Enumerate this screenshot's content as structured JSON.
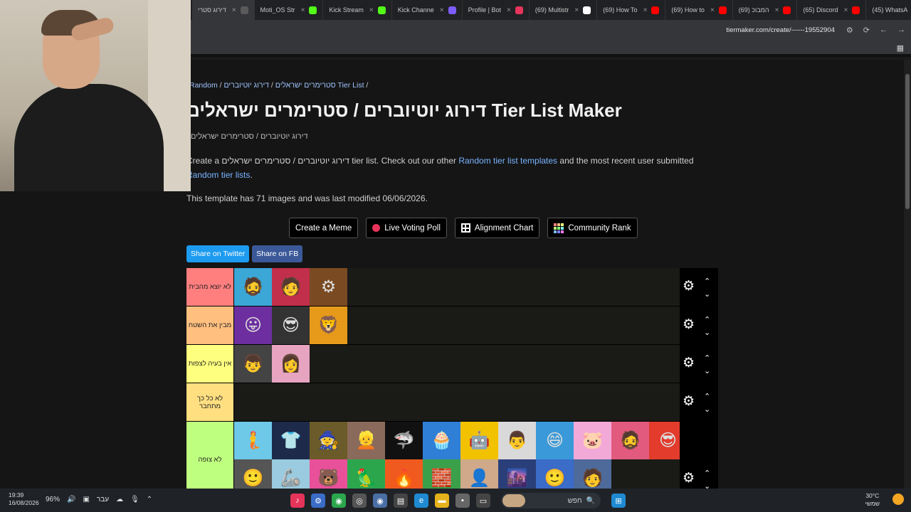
{
  "tabs": [
    {
      "title": "דירוג סטרי",
      "color": "#5a5a5a",
      "active": true
    },
    {
      "title": "Moti_OS Str",
      "color": "#53fc18"
    },
    {
      "title": "Kick Stream",
      "color": "#53fc18"
    },
    {
      "title": "Kick Channe",
      "color": "#7c5cfc"
    },
    {
      "title": "Profile | Bot",
      "color": "#e6345a"
    },
    {
      "title": "(69) Multistr",
      "color": "#ffffff"
    },
    {
      "title": "(69) How To",
      "color": "#ff0000"
    },
    {
      "title": "(69) How to",
      "color": "#ff0000"
    },
    {
      "title": "(69) המבוכ",
      "color": "#ff0000"
    },
    {
      "title": "(65) Discord",
      "color": "#ff0000"
    },
    {
      "title": "(45) WhatsA",
      "color": "#e6345a"
    }
  ],
  "address": {
    "url": "tiermaker.com/create/------19552904"
  },
  "breadcrumb": {
    "a": "Random",
    "b": "סטרימרים ישראלים",
    "c": "דירוג יוטיוברים Tier List",
    "sep": " / "
  },
  "title": "דירוג יוטיוברים / סטרימרים ישראלים Tier List Maker",
  "subtitle": "דירוג יוטיוברים / סטרימרים ישראלים",
  "description": {
    "pre": "Create a דירוג יוטיוברים / סטרימרים ישראלים tier list. Check out our other ",
    "link1": "Random tier list templates",
    "mid": " and the most recent user submitted ",
    "link2": "Random tier lists",
    "post": "."
  },
  "modified": "This template has 71 images and was last modified 06/06/2026.",
  "buttons": {
    "meme": "Create a Meme",
    "poll": "Live Voting Poll",
    "alignment": "Alignment Chart",
    "community": "Community Rank"
  },
  "share": {
    "twitter": "Share on Twitter",
    "fb": "Share on FB"
  },
  "tiers": [
    {
      "label": "לא יוצא מהבית",
      "color": "#ff7f7f"
    },
    {
      "label": "מבין את השטח",
      "color": "#ffbf7f"
    },
    {
      "label": "אין בעיה לצפות",
      "color": "#ffff7f"
    },
    {
      "label": "לא כל כך מתחבר",
      "color": "#ffdf80"
    },
    {
      "label": "לא צופה",
      "color": "#bfff7f"
    }
  ],
  "tier_items": {
    "t0": [
      {
        "icon": "🧔",
        "bg": "#3aa7d6"
      },
      {
        "icon": "🧑",
        "bg": "#c12f4a"
      },
      {
        "icon": "⚙",
        "bg": "#7a4a22"
      }
    ],
    "t1": [
      {
        "icon": "😛",
        "bg": "#6d2fa0"
      },
      {
        "icon": "😎",
        "bg": "#333333"
      },
      {
        "icon": "🦁",
        "bg": "#e79a1a"
      }
    ],
    "t2": [
      {
        "icon": "👦",
        "bg": "#444444"
      },
      {
        "icon": "👩",
        "bg": "#e6a4c0"
      }
    ],
    "t3": [],
    "t4": [
      {
        "icon": "🧜",
        "bg": "#6ec9e8"
      },
      {
        "icon": "👕",
        "bg": "#1e2a4a"
      },
      {
        "icon": "🧙",
        "bg": "#6b5b2a"
      },
      {
        "icon": "👱",
        "bg": "#8a6a5a"
      },
      {
        "icon": "🦈",
        "bg": "#111111"
      },
      {
        "icon": "🧁",
        "bg": "#2f7fd6"
      },
      {
        "icon": "🤖",
        "bg": "#f2c200"
      },
      {
        "icon": "👨",
        "bg": "#d9d9d9"
      },
      {
        "icon": "😄",
        "bg": "#3a9ad9"
      },
      {
        "icon": "🐷",
        "bg": "#f3a9d7"
      },
      {
        "icon": "🧔",
        "bg": "#e25a7e"
      },
      {
        "icon": "😎",
        "bg": "#e33b2c"
      },
      {
        "icon": "🙂",
        "bg": "#555555"
      },
      {
        "icon": "🦾",
        "bg": "#9acbe0"
      },
      {
        "icon": "🐻",
        "bg": "#e8509a"
      },
      {
        "icon": "🦜",
        "bg": "#2ba64d"
      },
      {
        "icon": "🔥",
        "bg": "#f15a1f"
      },
      {
        "icon": "🧱",
        "bg": "#3aa04a"
      },
      {
        "icon": "👤",
        "bg": "#cfa98a"
      },
      {
        "icon": "🌆",
        "bg": "#2a3f7a"
      },
      {
        "icon": "🙂",
        "bg": "#3a6cc8"
      },
      {
        "icon": "🧑",
        "bg": "#4d6a9a"
      }
    ]
  },
  "taskbar": {
    "time": "19:39",
    "date": "16/08/2026",
    "battery": "96%",
    "lang": "עבר",
    "search": "חפש",
    "temp": "30°C",
    "weather": "שמשי"
  }
}
